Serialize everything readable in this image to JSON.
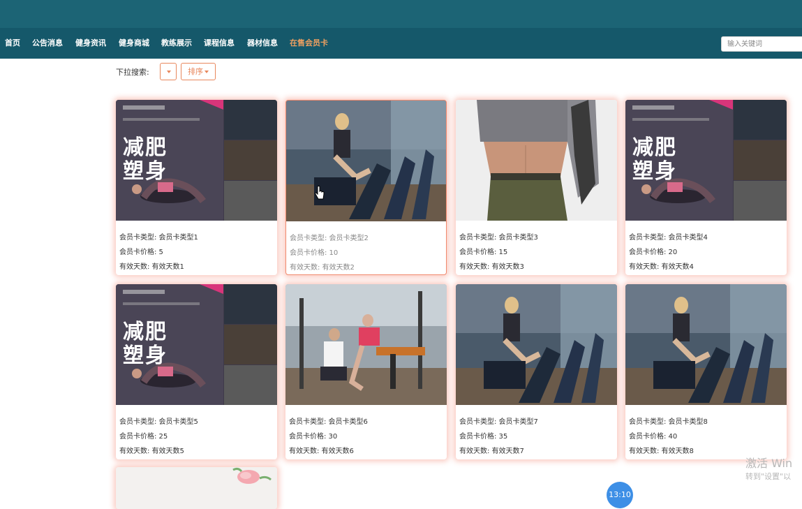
{
  "nav": {
    "items": [
      "首页",
      "公告消息",
      "健身资讯",
      "健身商城",
      "教练展示",
      "课程信息",
      "器材信息",
      "在售会员卡"
    ],
    "active_index": 7
  },
  "search": {
    "placeholder": "输入关键词"
  },
  "filter": {
    "label": "下拉搜索:",
    "dropdown_label": "",
    "sort_label": "排序"
  },
  "cards": [
    {
      "type": "会员卡类型: 会员卡类型1",
      "price": "会员卡价格: 5",
      "days": "有效天数: 有效天数1",
      "image": "fitness-poster"
    },
    {
      "type": "会员卡类型: 会员卡类型2",
      "price": "会员卡价格: 10",
      "days": "有效天数: 有效天数2",
      "image": "gym-bike-woman"
    },
    {
      "type": "会员卡类型: 会员卡类型3",
      "price": "会员卡价格: 15",
      "days": "有效天数: 有效天数3",
      "image": "abs-woman"
    },
    {
      "type": "会员卡类型: 会员卡类型4",
      "price": "会员卡价格: 20",
      "days": "有效天数: 有效天数4",
      "image": "fitness-poster"
    },
    {
      "type": "会员卡类型: 会员卡类型5",
      "price": "会员卡价格: 25",
      "days": "有效天数: 有效天数5",
      "image": "fitness-poster"
    },
    {
      "type": "会员卡类型: 会员卡类型6",
      "price": "会员卡价格: 30",
      "days": "有效天数: 有效天数6",
      "image": "gym-trainer"
    },
    {
      "type": "会员卡类型: 会员卡类型7",
      "price": "会员卡价格: 35",
      "days": "有效天数: 有效天数7",
      "image": "gym-bike-woman"
    },
    {
      "type": "会员卡类型: 会员卡类型8",
      "price": "会员卡价格: 40",
      "days": "有效天数: 有效天数8",
      "image": "gym-bike-woman"
    }
  ],
  "poster": {
    "title_line1": "减肥",
    "title_line2": "塑身"
  },
  "watermark": {
    "line1": "激活 Win",
    "line2": "转到\"设置\"以"
  },
  "time_badge": "13:10",
  "colors": {
    "topbar": "#1c6475",
    "navbar": "#15586a",
    "active_nav": "#f0a060",
    "accent": "#e8875c",
    "card_glow": "#f58c78"
  }
}
